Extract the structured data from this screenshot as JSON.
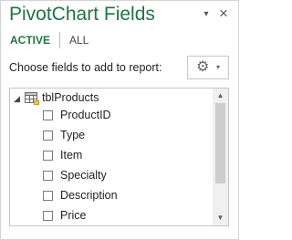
{
  "pane": {
    "title": "PivotChart Fields",
    "options_glyph": "▾",
    "close_glyph": "×",
    "accent_color": "#217346"
  },
  "tabs": [
    {
      "label": "ACTIVE",
      "selected": true
    },
    {
      "label": "ALL",
      "selected": false
    }
  ],
  "prompt": "Choose fields to add to report:",
  "tools_button": {
    "icon": "gear-icon",
    "gear_glyph": "⚙",
    "caret_glyph": "▾"
  },
  "field_list": {
    "table": {
      "name": "tblProducts",
      "icon": "table-icon",
      "expand_glyph": "◢",
      "expanded": true
    },
    "fields": [
      {
        "label": "ProductID",
        "checked": false
      },
      {
        "label": "Type",
        "checked": false
      },
      {
        "label": "Item",
        "checked": false
      },
      {
        "label": "Specialty",
        "checked": false
      },
      {
        "label": "Description",
        "checked": false
      },
      {
        "label": "Price",
        "checked": false
      }
    ],
    "scroll": {
      "up_glyph": "▲",
      "down_glyph": "▼"
    }
  }
}
